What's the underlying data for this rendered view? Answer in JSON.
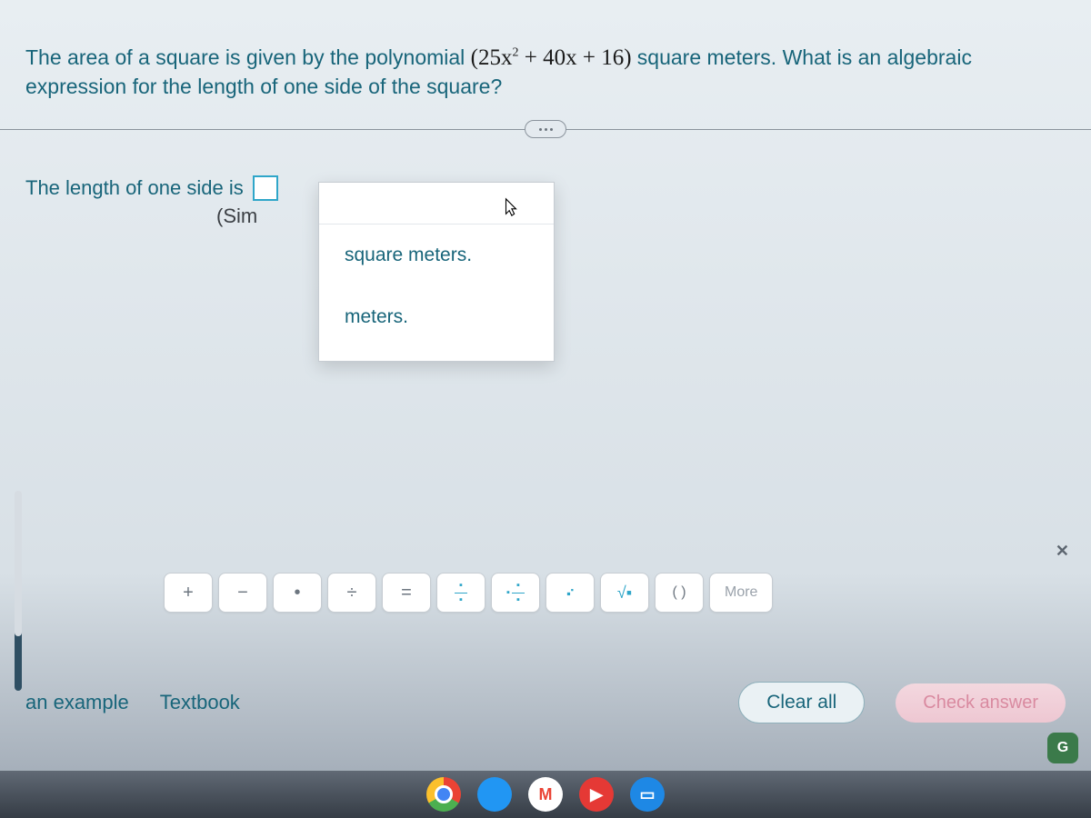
{
  "question": {
    "prefix": "The area of a square is given by the polynomial ",
    "polynomial_open": "(",
    "poly_a": "25x",
    "poly_exp": "2",
    "poly_rest": " + 40x + 16",
    "polynomial_close": ")",
    "suffix": " square meters. What is an algebraic expression for the length of one side of the square?"
  },
  "answer": {
    "label_prefix": "The length of one side is",
    "hint": "(Sim"
  },
  "dropdown": {
    "items": [
      "square meters.",
      "meters."
    ]
  },
  "toolbar": {
    "plus": "+",
    "minus": "−",
    "dot": "•",
    "divide": "÷",
    "equals": "=",
    "paren": "(   )",
    "more": "More"
  },
  "actions": {
    "example": "an example",
    "textbook": "Textbook",
    "clear": "Clear all",
    "check": "Check answer"
  },
  "taskbar": {
    "gmail": "M",
    "yt": "▶",
    "word": "▭",
    "corner": "G"
  }
}
